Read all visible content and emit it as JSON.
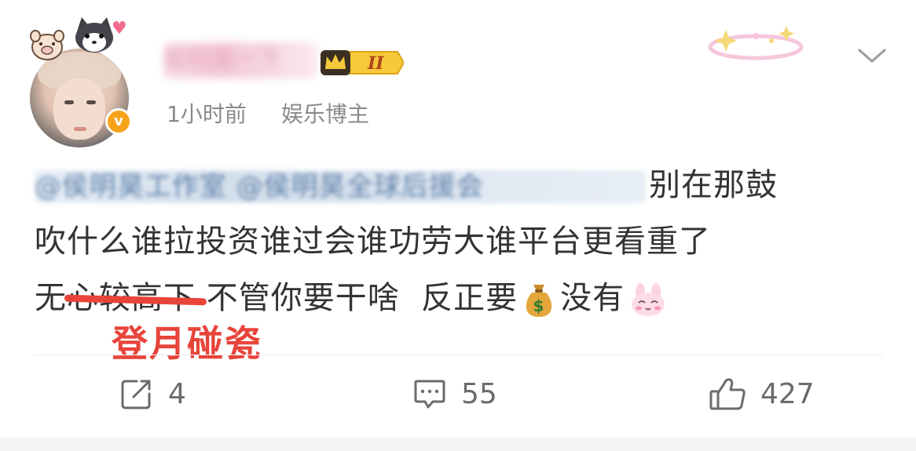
{
  "post": {
    "author": {
      "name": "侯明昊一下",
      "time": "1小时前",
      "source": "娱乐博主",
      "vip_level": "II",
      "verified": "v"
    },
    "content": {
      "mentions": "@侯明昊工作室 @侯明昊全球后援会",
      "line1_tail": "别在那鼓",
      "line2": "吹什么谁拉投资谁过会谁功劳大谁平台更看重了",
      "line3_prefix": "无心",
      "line3_struck": "较高下",
      "line3_middle": " 不管你要干啥  反正要",
      "line3_tail": "没有",
      "emoji_money": "money-bag-icon",
      "emoji_bunny": "bunny-face-icon"
    },
    "annotation": "登月碰瓷",
    "actions": {
      "repost_count": "4",
      "comment_count": "55",
      "like_count": "427"
    }
  }
}
